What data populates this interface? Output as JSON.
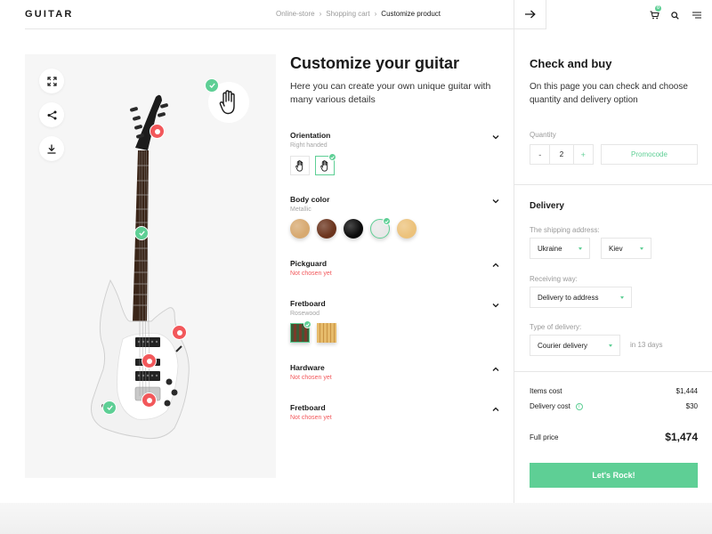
{
  "header": {
    "logo": "GUITAR",
    "breadcrumb": [
      "Online-store",
      "Shopping cart",
      "Customize product"
    ],
    "cart_count": "0"
  },
  "customize": {
    "title": "Customize your guitar",
    "description": "Here you can create your own unique guitar with many various details",
    "options": [
      {
        "name": "Orientation",
        "value": "Right handed",
        "missing": false,
        "expanded": true
      },
      {
        "name": "Body color",
        "value": "Metallic",
        "missing": false,
        "expanded": true
      },
      {
        "name": "Pickguard",
        "value": "Not chosen yet",
        "missing": true,
        "expanded": false
      },
      {
        "name": "Fretboard",
        "value": "Rosewood",
        "missing": false,
        "expanded": true
      },
      {
        "name": "Hardware",
        "value": "Not chosen yet",
        "missing": true,
        "expanded": false
      },
      {
        "name": "Fretboard",
        "value": "Not chosen yet",
        "missing": true,
        "expanded": false
      }
    ],
    "body_colors": [
      "#d7a970",
      "#6b341d",
      "#0b0b0b",
      "#e8e8e8",
      "#ecc27b"
    ],
    "selected_body_color_index": 3
  },
  "checkout": {
    "title": "Check and buy",
    "description": "On this page you can check and choose quantity and delivery option",
    "quantity_label": "Quantity",
    "quantity_minus": "-",
    "quantity": "2",
    "quantity_plus": "+",
    "promocode": "Promocode",
    "delivery": {
      "title": "Delivery",
      "address_label": "The shipping address:",
      "country": "Ukraine",
      "city": "Kiev",
      "receiving_label": "Receiving way:",
      "receiving": "Delivery to address",
      "type_label": "Type of delivery:",
      "type": "Courier delivery",
      "eta": "in 13 days"
    },
    "summary": {
      "items_cost_label": "Items cost",
      "items_cost": "$1,444",
      "delivery_cost_label": "Delivery cost",
      "delivery_cost": "$30",
      "full_price_label": "Full price",
      "full_price": "$1,474"
    },
    "cta": "Let's Rock!"
  },
  "colors": {
    "accent": "#5ecf95",
    "alert": "#f2585b"
  }
}
